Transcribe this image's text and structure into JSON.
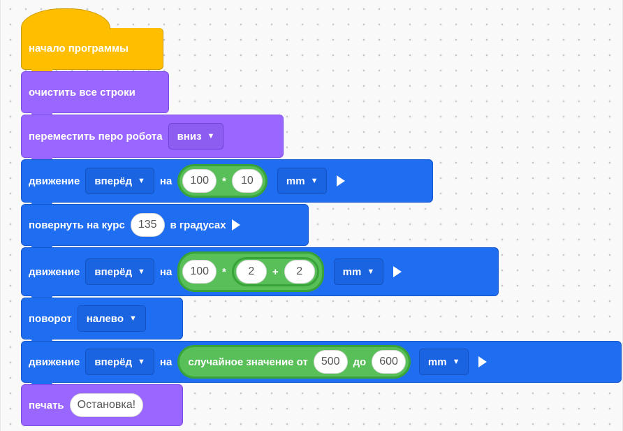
{
  "blocks": {
    "start": {
      "label": "начало программы"
    },
    "clear": {
      "label": "очистить все строки"
    },
    "pen": {
      "label": "переместить перо робота",
      "dropdown": "вниз"
    },
    "move1": {
      "label": "движение",
      "direction": "вперёд",
      "on": "на",
      "a": "100",
      "op": "*",
      "b": "10",
      "unit": "mm"
    },
    "turn": {
      "label": "повернуть на курс",
      "value": "135",
      "suffix": "в градусах"
    },
    "move2": {
      "label": "движение",
      "direction": "вперёд",
      "on": "на",
      "a": "100",
      "op1": "*",
      "b": "2",
      "op2": "+",
      "c": "2",
      "unit": "mm"
    },
    "rotate": {
      "label": "поворот",
      "direction": "налево"
    },
    "move3": {
      "label": "движение",
      "direction": "вперёд",
      "on": "на",
      "random_label": "случайное значение от",
      "from": "500",
      "to_label": "до",
      "to": "600",
      "unit": "mm"
    },
    "print": {
      "label": "печать",
      "value": "Остановка!"
    }
  },
  "icons": {
    "caret": "▼",
    "run": "play-icon"
  },
  "colors": {
    "events": "#ffbf00",
    "looks": "#9966ff",
    "motion": "#1f6df0",
    "operators": "#59c059",
    "canvas": "#f9f9f9"
  }
}
